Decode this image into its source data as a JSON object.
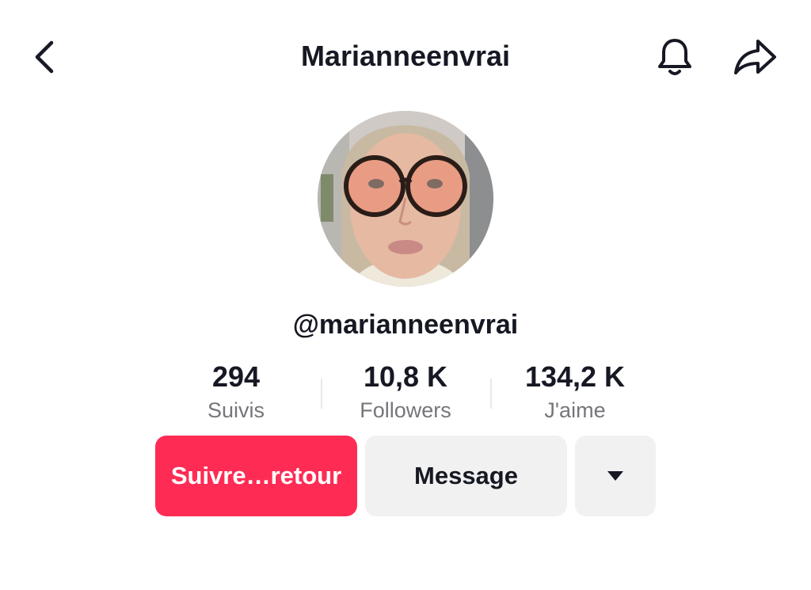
{
  "header": {
    "title": "Marianneenvrai",
    "back_icon": "chevron-left-icon",
    "notification_icon": "bell-icon",
    "share_icon": "share-arrow-icon"
  },
  "profile": {
    "handle": "@marianneenvrai",
    "avatar": "avatar-photo"
  },
  "stats": {
    "following": {
      "value": "294",
      "label": "Suivis"
    },
    "followers": {
      "value": "10,8 K",
      "label": "Followers"
    },
    "likes": {
      "value": "134,2 K",
      "label": "J'aime"
    }
  },
  "actions": {
    "follow_back_label": "Suivre…retour",
    "message_label": "Message",
    "more_icon": "caret-down-icon"
  },
  "colors": {
    "accent": "#fe2c55",
    "text_primary": "#161823",
    "text_secondary": "#75767b",
    "button_secondary_bg": "#f1f1f2"
  }
}
